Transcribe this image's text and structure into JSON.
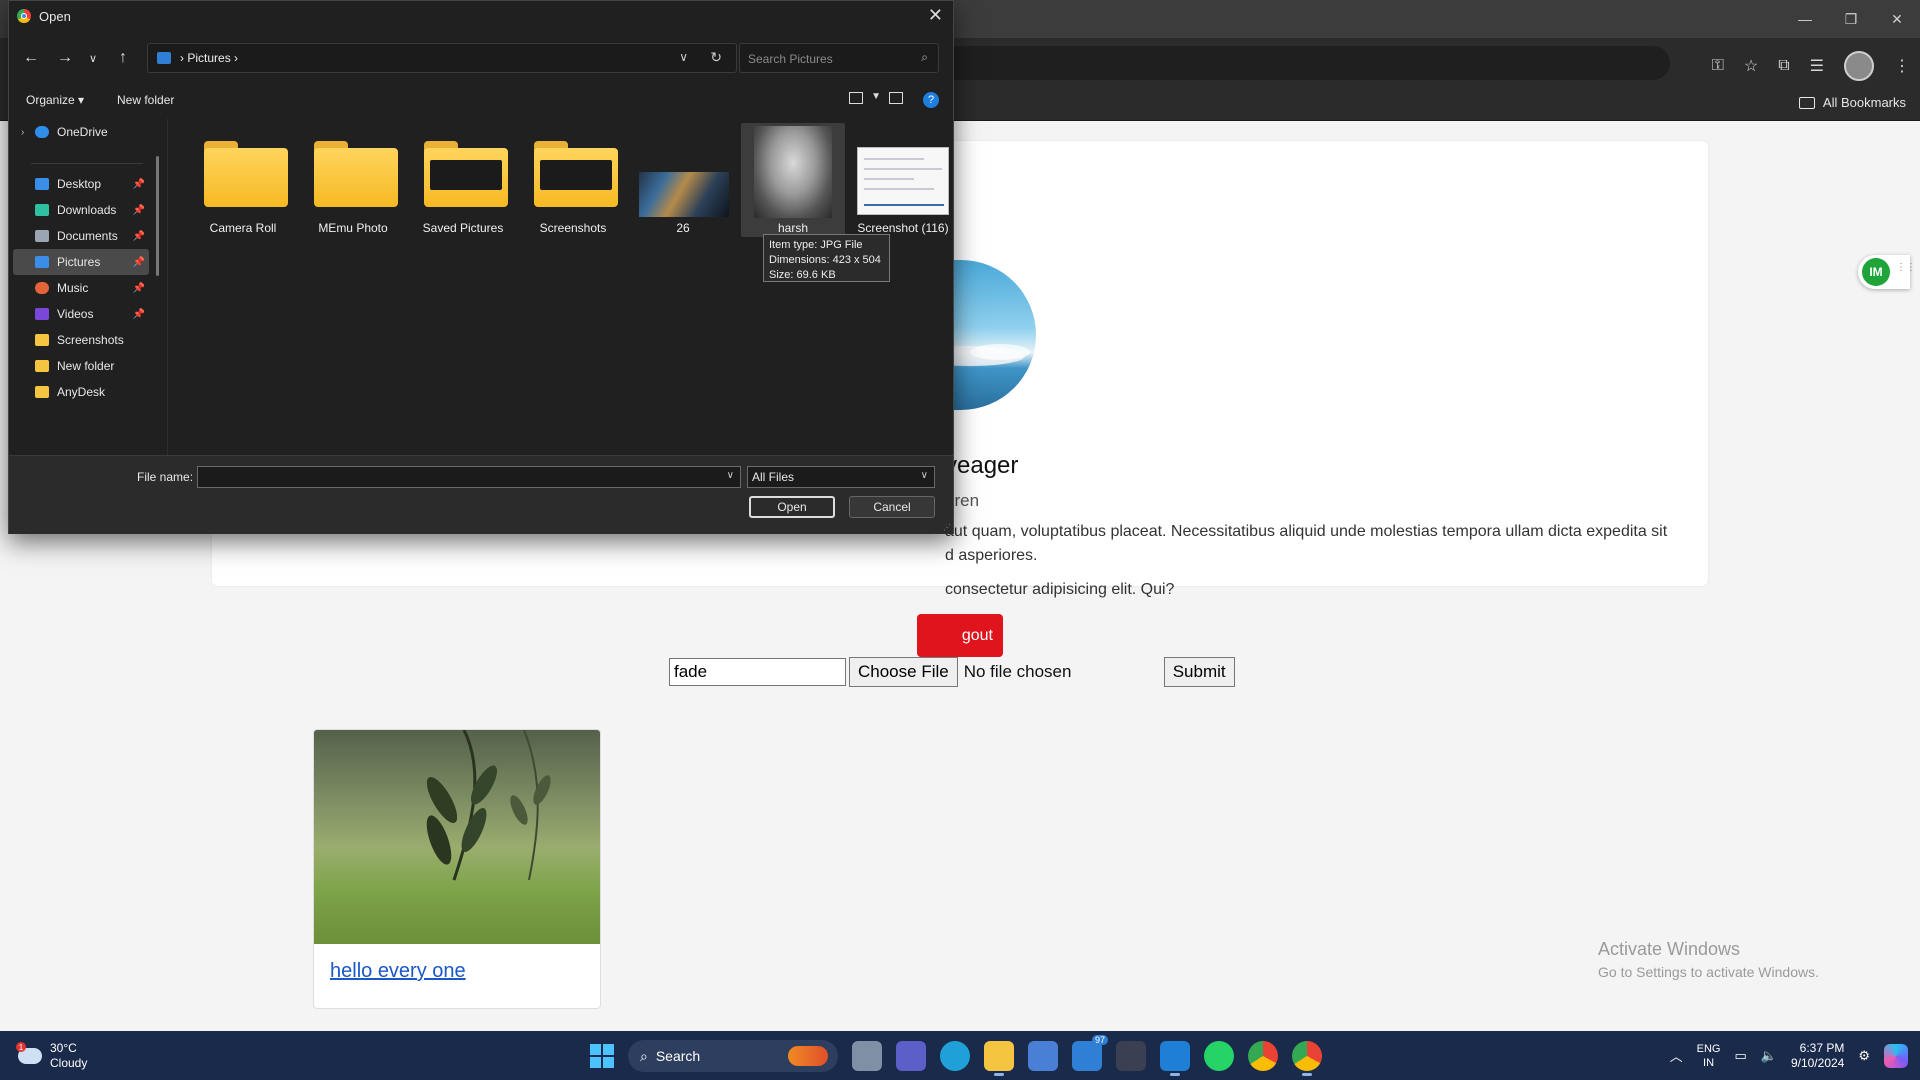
{
  "browser": {
    "bookmarks_label": "All Bookmarks"
  },
  "page": {
    "profile_name": "yeager",
    "profile_handle": "eren",
    "bio_line1": "aut quam, voluptatibus placeat. Necessitatibus aliquid unde molestias tempora ullam dicta expedita sit",
    "bio_line2": "d asperiores.",
    "bio_line3": "consectetur adipisicing elit. Qui?",
    "logout_label": "gout",
    "text_value": "fade",
    "choose_file_label": "Choose File",
    "no_file_label": "No file chosen",
    "submit_label": "Submit",
    "post_link": "hello every one",
    "fab_label": "IM"
  },
  "activation": {
    "title": "Activate Windows",
    "subtitle": "Go to Settings to activate Windows."
  },
  "dialog": {
    "title": "Open",
    "breadcrumb": "Pictures",
    "search_placeholder": "Search Pictures",
    "organize_label": "Organize",
    "new_folder_label": "New folder",
    "nav_items": [
      {
        "label": "OneDrive",
        "icon": "cloud-icon",
        "color": "#2f8fe8"
      },
      {
        "label": "Desktop",
        "icon": "desktop-icon",
        "color": "#3a8ee6",
        "pinned": true
      },
      {
        "label": "Downloads",
        "icon": "download-icon",
        "color": "#2ec0a0",
        "pinned": true
      },
      {
        "label": "Documents",
        "icon": "document-icon",
        "color": "#9aa4b3",
        "pinned": true
      },
      {
        "label": "Pictures",
        "icon": "pictures-icon",
        "color": "#3a8ee6",
        "pinned": true,
        "selected": true
      },
      {
        "label": "Music",
        "icon": "music-icon",
        "color": "#e3633a",
        "pinned": true
      },
      {
        "label": "Videos",
        "icon": "video-icon",
        "color": "#7a48d8",
        "pinned": true
      },
      {
        "label": "Screenshots",
        "icon": "folder-icon",
        "color": "#f5c542"
      },
      {
        "label": "New folder",
        "icon": "folder-icon",
        "color": "#f5c542"
      },
      {
        "label": "AnyDesk",
        "icon": "folder-icon",
        "color": "#f5c542"
      }
    ],
    "files": [
      {
        "label": "Camera Roll",
        "kind": "folder"
      },
      {
        "label": "MEmu Photo",
        "kind": "folder"
      },
      {
        "label": "Saved Pictures",
        "kind": "folder-preview"
      },
      {
        "label": "Screenshots",
        "kind": "folder-preview"
      },
      {
        "label": "26",
        "kind": "image"
      },
      {
        "label": "harsh",
        "kind": "image",
        "selected": true
      },
      {
        "label": "Screenshot (116)",
        "kind": "image"
      }
    ],
    "tooltip": {
      "line1": "Item type: JPG File",
      "line2": "Dimensions: 423 x 504",
      "line3": "Size: 69.6 KB"
    },
    "file_name_label": "File name:",
    "file_name_value": "",
    "filter_value": "All Files",
    "open_label": "Open",
    "cancel_label": "Cancel"
  },
  "taskbar": {
    "temperature": "30°C",
    "weather": "Cloudy",
    "weather_badge": "1",
    "search_label": "Search",
    "mail_count": "97",
    "lang1": "ENG",
    "lang2": "IN",
    "time": "6:37 PM",
    "date": "9/10/2024"
  }
}
